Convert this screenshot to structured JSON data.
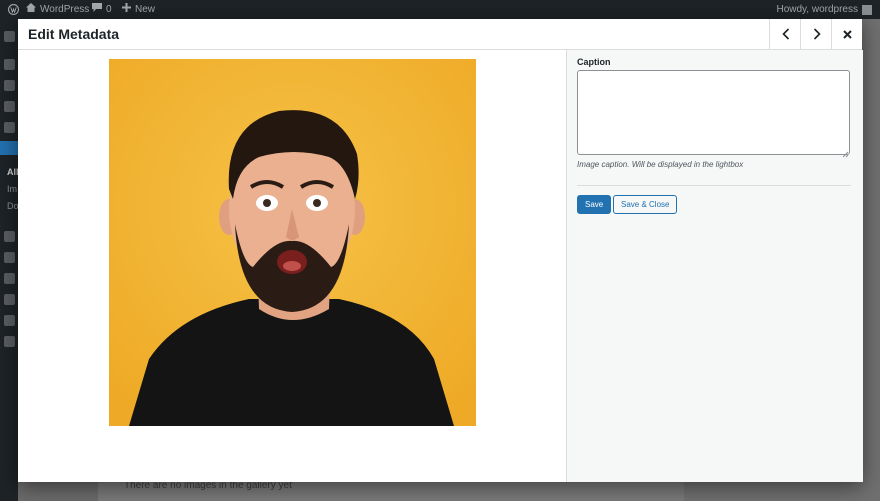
{
  "adminbar": {
    "site_name": "WordPress",
    "comment_count": "0",
    "new_label": "New",
    "howdy": "Howdy, wordpress"
  },
  "sidebar": {
    "submenu": [
      "All",
      "Im",
      "Do"
    ]
  },
  "underlay": {
    "empty_text": "There are no images in the gallery yet"
  },
  "modal": {
    "title": "Edit Metadata",
    "prev_icon": "chevron-left-icon",
    "next_icon": "chevron-right-icon",
    "close_icon": "close-icon"
  },
  "details": {
    "caption_label": "Caption",
    "caption_value": "",
    "caption_help": "Image caption. Will be displayed in the lightbox",
    "save_label": "Save",
    "save_close_label": "Save & Close"
  },
  "colors": {
    "accent": "#2271b1",
    "admin_bar": "#1d2327",
    "photo_background": "#f3b633"
  }
}
